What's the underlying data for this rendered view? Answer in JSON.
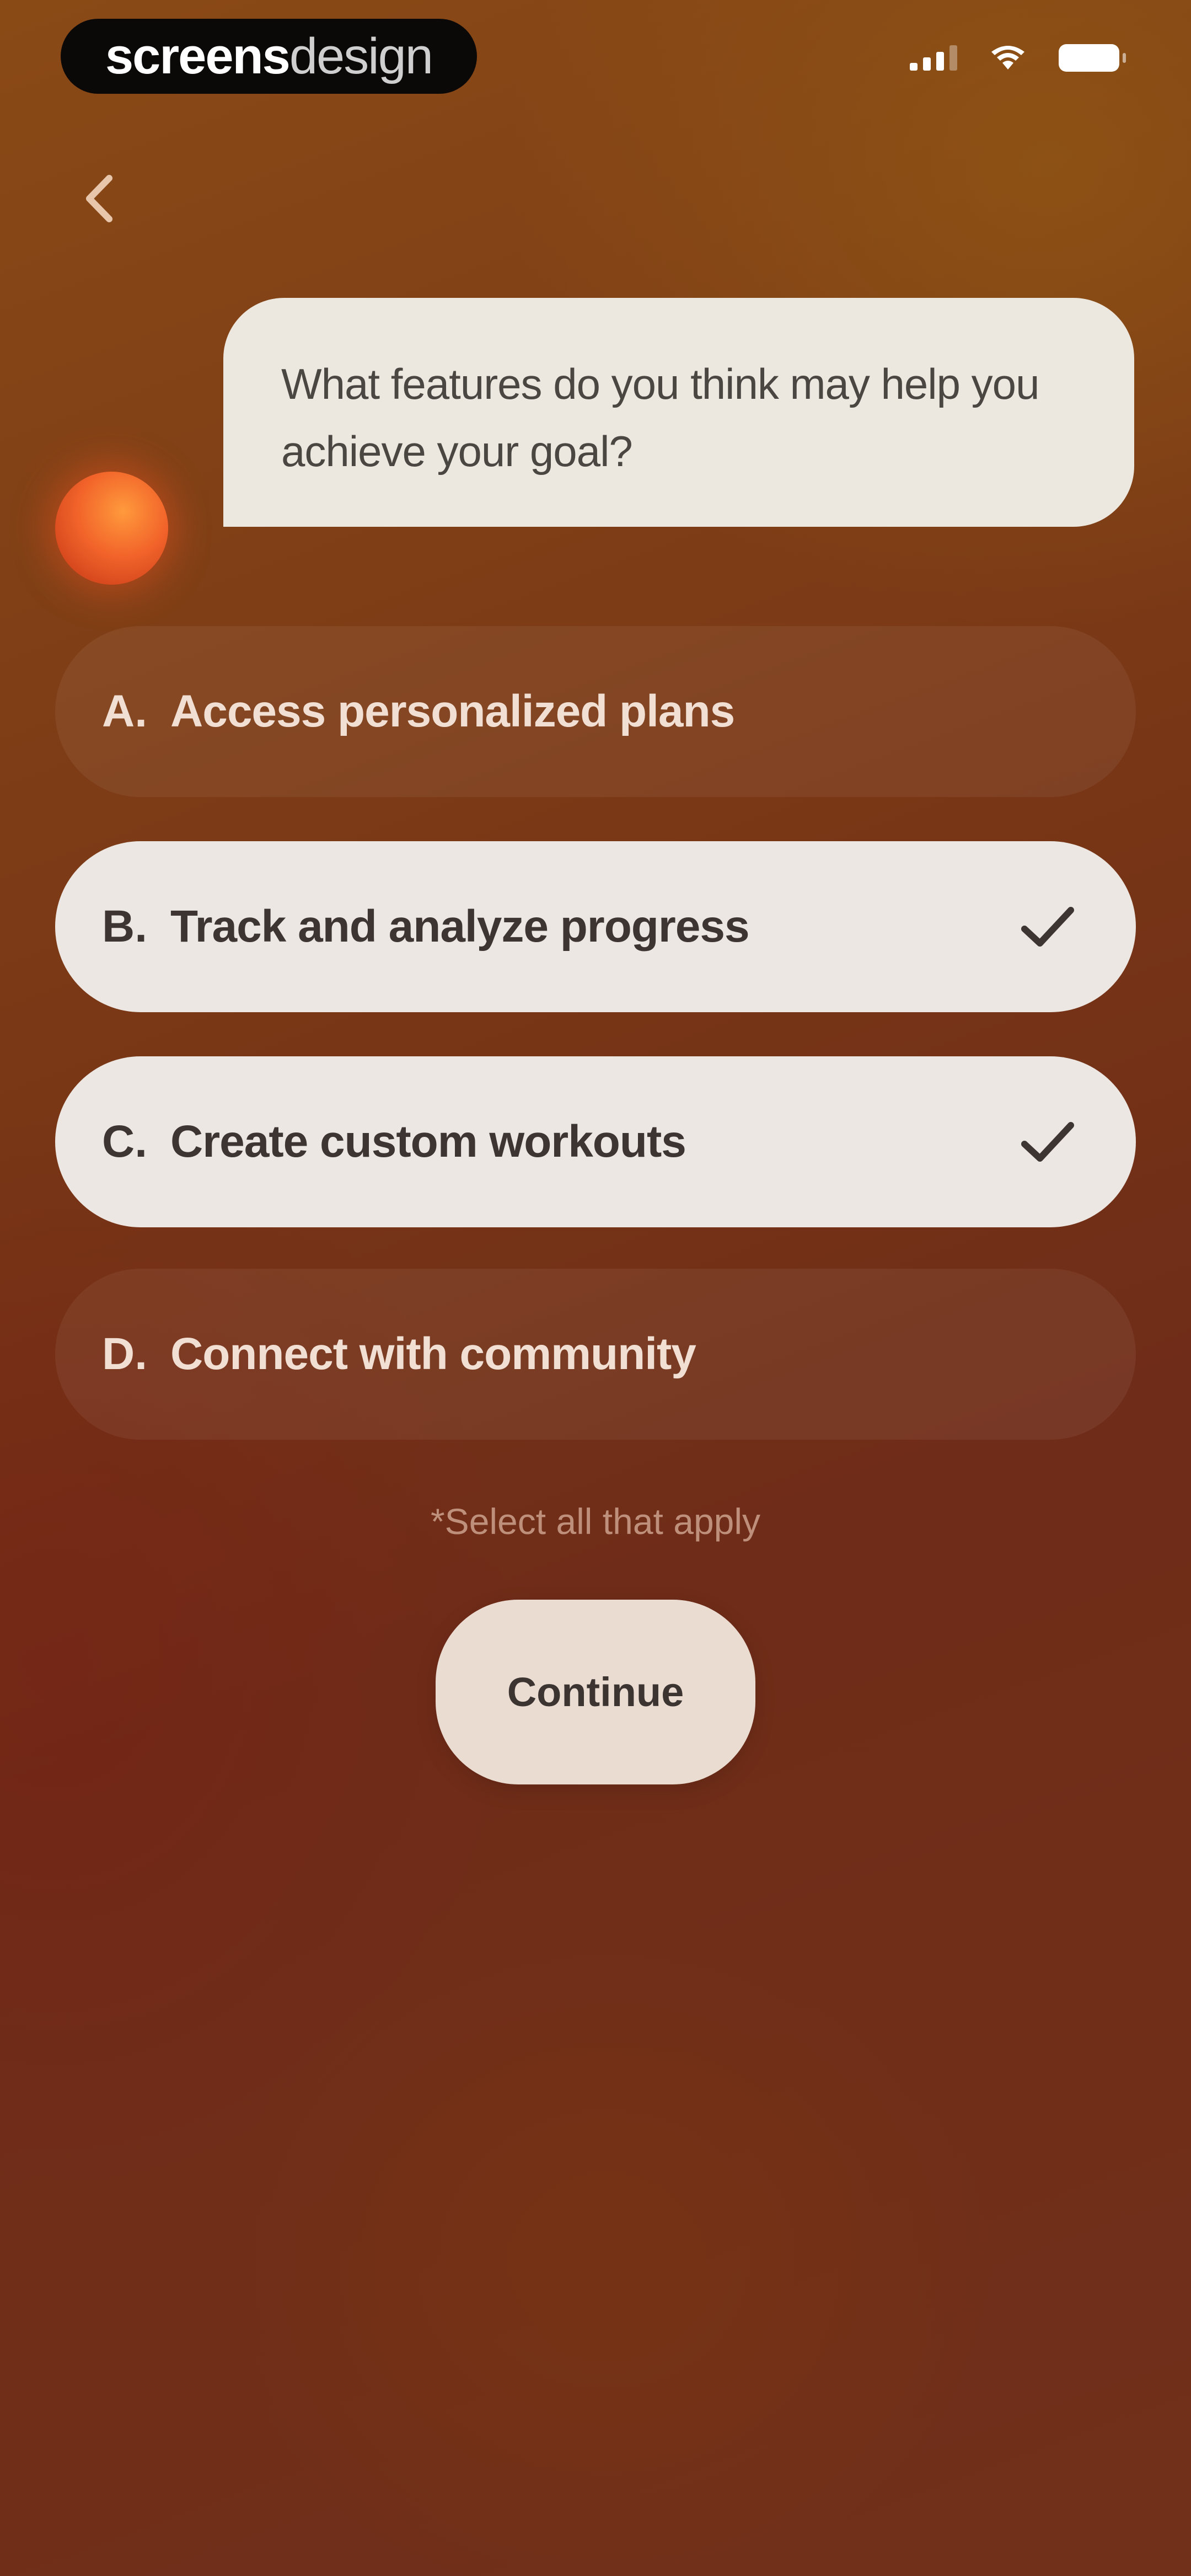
{
  "status_bar": {
    "brand_part1": "screens",
    "brand_part2": "design",
    "icons": [
      "cellular-signal-icon",
      "wifi-icon",
      "battery-icon"
    ]
  },
  "navigation": {
    "back_icon": "chevron-left-icon"
  },
  "assistant": {
    "avatar": "orb-avatar",
    "question": "What features do you think may help you achieve your goal?"
  },
  "options": [
    {
      "letter": "A.",
      "label": "Access personalized plans",
      "selected": false
    },
    {
      "letter": "B.",
      "label": "Track and analyze progress",
      "selected": true
    },
    {
      "letter": "C.",
      "label": "Create custom workouts",
      "selected": true
    },
    {
      "letter": "D.",
      "label": "Connect with community",
      "selected": false
    }
  ],
  "hint": "*Select all that apply",
  "continue_label": "Continue",
  "colors": {
    "background": "#7a3816",
    "selected_option": "#ece7e2",
    "bubble": "#ece8df",
    "accent_orb": "#f2642a"
  }
}
